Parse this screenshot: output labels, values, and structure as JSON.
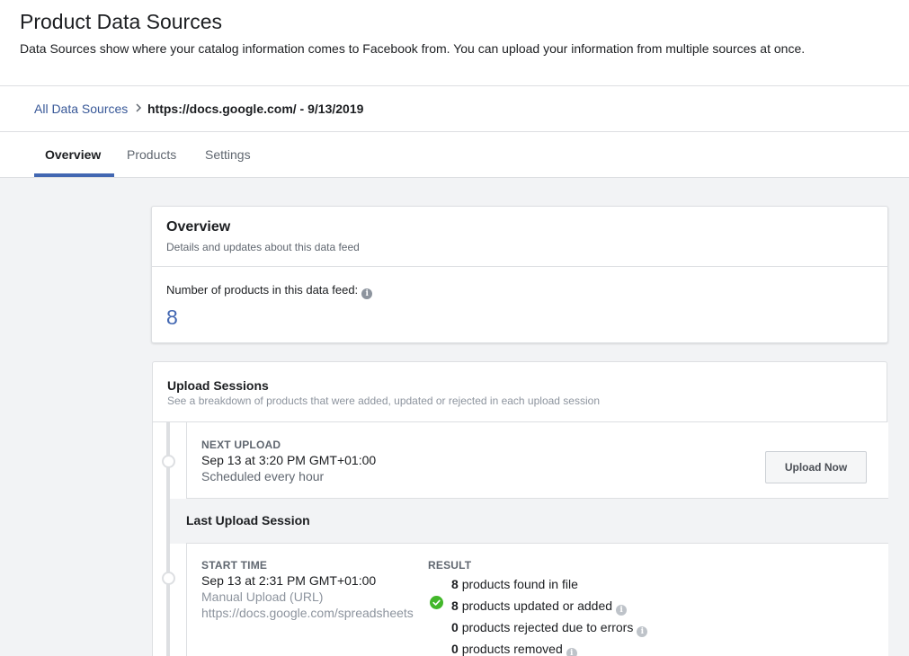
{
  "header": {
    "title": "Product Data Sources",
    "description": "Data Sources show where your catalog information comes to Facebook from. You can upload your information from multiple sources at once."
  },
  "breadcrumb": {
    "root": "All Data Sources",
    "current": "https://docs.google.com/ - 9/13/2019"
  },
  "tabs": [
    {
      "label": "Overview",
      "active": true
    },
    {
      "label": "Products",
      "active": false
    },
    {
      "label": "Settings",
      "active": false
    }
  ],
  "overview": {
    "title": "Overview",
    "subtitle": "Details and updates about this data feed",
    "count_label": "Number of products in this data feed:",
    "count": "8"
  },
  "upload_sessions": {
    "title": "Upload Sessions",
    "subtitle": "See a breakdown of products that were added, updated or rejected in each upload session",
    "next_upload": {
      "label": "NEXT UPLOAD",
      "time": "Sep 13 at 3:20 PM GMT+01:00",
      "schedule": "Scheduled every hour",
      "button": "Upload Now"
    },
    "last_session": {
      "title": "Last Upload Session",
      "start_label": "START TIME",
      "start_time": "Sep 13 at 2:31 PM GMT+01:00",
      "method": "Manual Upload (URL)",
      "url": "https://docs.google.com/spreadsheets",
      "result_label": "RESULT",
      "results": [
        {
          "count": "8",
          "text": "products found in file"
        },
        {
          "count": "8",
          "text": "products updated or added"
        },
        {
          "count": "0",
          "text": "products rejected due to errors"
        },
        {
          "count": "0",
          "text": "products removed"
        }
      ]
    }
  },
  "colors": {
    "accent": "#4267b2",
    "link": "#385898",
    "success": "#42b72a"
  },
  "icons": [
    "chevron-right-icon",
    "info-icon",
    "check-circle-icon"
  ]
}
